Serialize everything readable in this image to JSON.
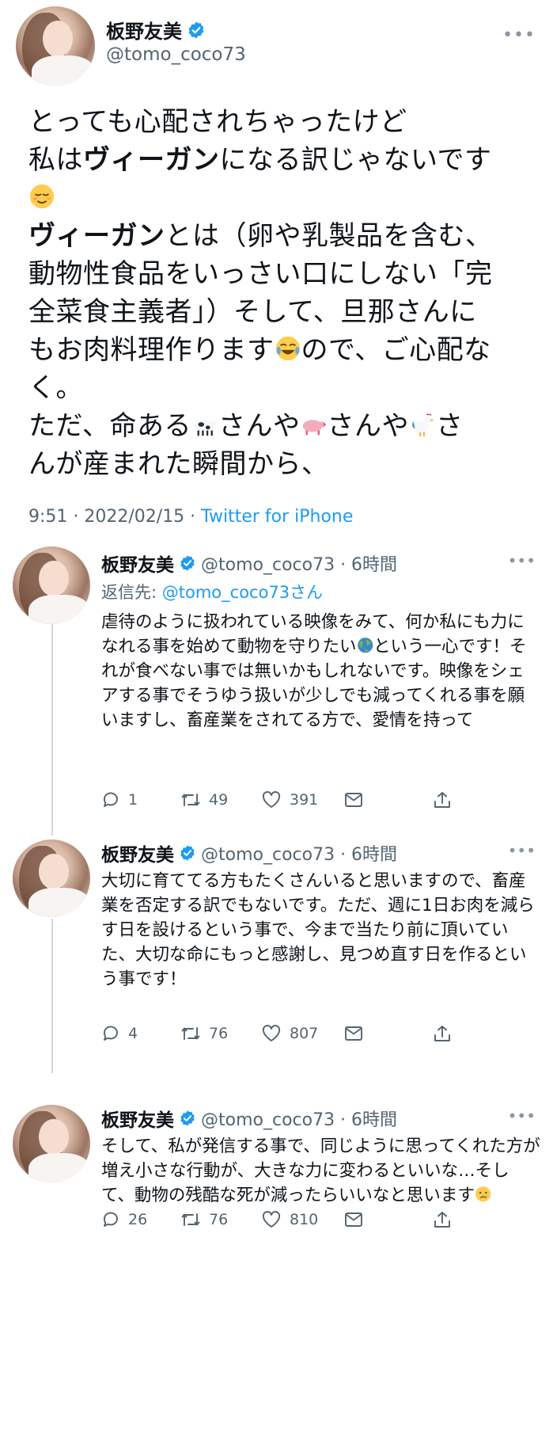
{
  "main_tweet": {
    "name": "板野友美",
    "handle": "@tomo_coco73",
    "more_icon": "more-dots-icon",
    "lines": [
      "とっても心配されちゃったけど",
      "私は",
      "ヴィーガン",
      "になる訳じゃないです",
      "ヴィーガン",
      "とは（卵や乳製品を含む、",
      "動物性食品をいっさい口にしない「完",
      "全菜食主義者」）そして、旦那さんに",
      "もお肉料理作ります",
      "ので、ご心配な",
      "く。",
      "ただ、命ある",
      "さんや",
      "さんや",
      "さ",
      "んが産まれた瞬間から、"
    ],
    "time": "9:51 · 2022/02/15 · ",
    "source": "Twitter for iPhone"
  },
  "replies": [
    {
      "name": "板野友美",
      "handle": "@tomo_coco73 · 6時間",
      "reply_to_label": "返信先: ",
      "reply_to_handle": "@tomo_coco73さん",
      "text_a": "虐待のように扱われている映像をみて、何か私にも力になれる事を始めて動物を守りたい",
      "text_b": "という一心です！それが食べない事では無いかもしれないです。映像をシェアする事でそうゆう扱いが少しでも減ってくれる事を願いますし、畜産業をされてる方で、愛情を持って",
      "reply_count": "1",
      "retweet_count": "49",
      "like_count": "391"
    },
    {
      "name": "板野友美",
      "handle": "@tomo_coco73 · 6時間",
      "text": "大切に育ててる方もたくさんいると思いますので、畜産業を否定する訳でもないです。ただ、週に1日お肉を減らす日を設けるという事で、今まで当たり前に頂いていた、大切な命にもっと感謝し、見つめ直す日を作るという事です！",
      "reply_count": "4",
      "retweet_count": "76",
      "like_count": "807"
    },
    {
      "name": "板野友美",
      "handle": "@tomo_coco73 · 6時間",
      "text": "そして、私が発信する事で、同じように思ってくれた方が増え小さな行動が、大きな力に変わるといいな…そして、動物の残酷な死が減ったらいいなと思います",
      "reply_count": "26",
      "retweet_count": "76",
      "like_count": "810"
    }
  ],
  "icons": {
    "reply": "reply-bubble-icon",
    "retweet": "retweet-icon",
    "like": "heart-icon",
    "dm": "envelope-icon",
    "share": "share-icon",
    "verified": "verified-badge-icon"
  },
  "colors": {
    "text": "#0f1419",
    "secondary": "#536471",
    "link": "#1d9bf0",
    "verified": "#1d9bf0"
  }
}
